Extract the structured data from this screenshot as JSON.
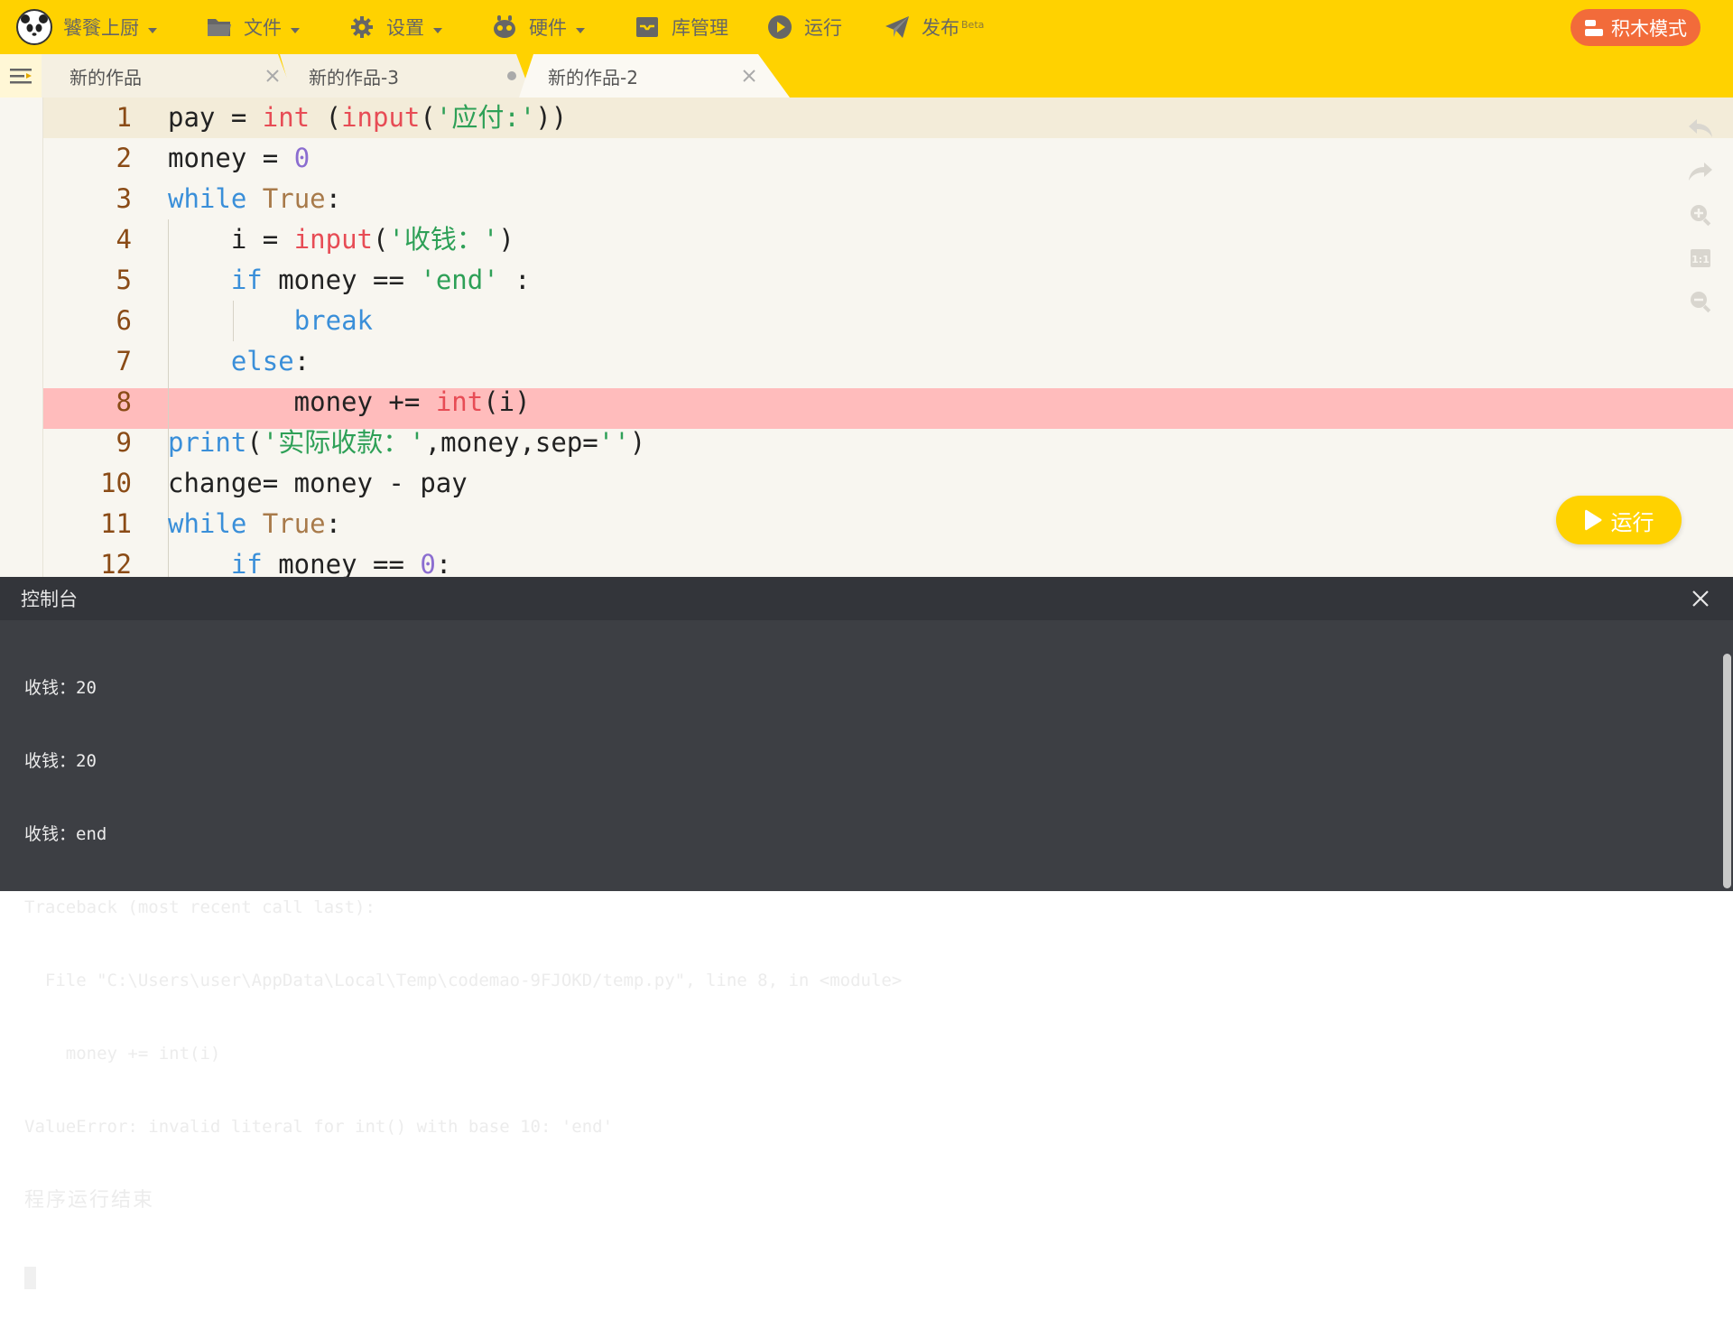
{
  "toolbar": {
    "user_name": "饕餮上厨",
    "file_label": "文件",
    "settings_label": "设置",
    "hardware_label": "硬件",
    "library_label": "库管理",
    "run_label": "运行",
    "publish_label": "发布",
    "publish_badge": "Beta",
    "block_mode_label": "积木模式",
    "accent_color": "#ffd200",
    "block_mode_color": "#f26b3a"
  },
  "tabs": [
    {
      "label": "新的作品",
      "state": "inactive",
      "indicator": "close"
    },
    {
      "label": "新的作品-3",
      "state": "inactive",
      "indicator": "unsaved-dot"
    },
    {
      "label": "新的作品-2",
      "state": "active",
      "indicator": "close"
    }
  ],
  "editor": {
    "current_line": 1,
    "error_line": 8,
    "line_numbers": [
      "1",
      "2",
      "3",
      "4",
      "5",
      "6",
      "7",
      "8",
      "9",
      "10",
      "11",
      "12"
    ],
    "run_button_label": "运行",
    "tools": [
      "undo-icon",
      "redo-icon",
      "zoom-in-icon",
      "zoom-reset-icon",
      "zoom-out-icon"
    ]
  },
  "console": {
    "title": "控制台",
    "lines": [
      "收钱：20",
      "收钱：20",
      "收钱：end",
      "Traceback (most recent call last):",
      "  File \"C:\\Users\\user\\AppData\\Local\\Temp\\codemao-9FJOKD/temp.py\", line 8, in <module>",
      "    money += int(i)",
      "ValueError: invalid literal for int() with base 10: 'end'",
      "程序运行结束"
    ]
  }
}
